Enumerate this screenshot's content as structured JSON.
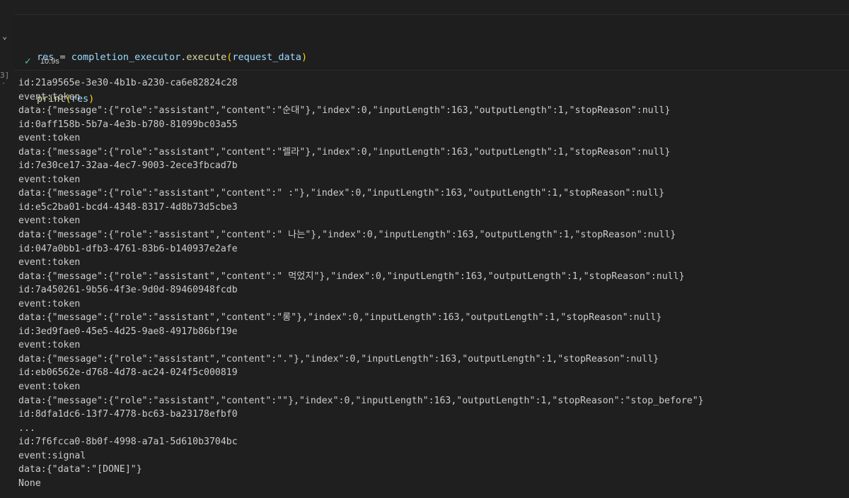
{
  "cell": {
    "code_line_1": {
      "var": "res",
      "op": " = ",
      "obj": "completion_executor",
      "dot": ".",
      "method": "execute",
      "open": "(",
      "arg": "request_data",
      "close": ")"
    },
    "code_line_2": {
      "fn": "print",
      "open": "(",
      "arg": "res",
      "close": ")"
    },
    "execution_count": "3]",
    "status_icon": "check-icon",
    "duration": "10.9s"
  },
  "output": {
    "lines": [
      "id:21a9565e-3e30-4b1b-a230-ca6e82824c28",
      "event:token",
      "data:{\"message\":{\"role\":\"assistant\",\"content\":\"순대\"},\"index\":0,\"inputLength\":163,\"outputLength\":1,\"stopReason\":null}",
      "id:0aff158b-5b7a-4e3b-b780-81099bc03a55",
      "event:token",
      "data:{\"message\":{\"role\":\"assistant\",\"content\":\"렐라\"},\"index\":0,\"inputLength\":163,\"outputLength\":1,\"stopReason\":null}",
      "id:7e30ce17-32aa-4ec7-9003-2ece3fbcad7b",
      "event:token",
      "data:{\"message\":{\"role\":\"assistant\",\"content\":\" :\"},\"index\":0,\"inputLength\":163,\"outputLength\":1,\"stopReason\":null}",
      "id:e5c2ba01-bcd4-4348-8317-4d8b73d5cbe3",
      "event:token",
      "data:{\"message\":{\"role\":\"assistant\",\"content\":\" 나는\"},\"index\":0,\"inputLength\":163,\"outputLength\":1,\"stopReason\":null}",
      "id:047a0bb1-dfb3-4761-83b6-b140937e2afe",
      "event:token",
      "data:{\"message\":{\"role\":\"assistant\",\"content\":\" 먹었지\"},\"index\":0,\"inputLength\":163,\"outputLength\":1,\"stopReason\":null}",
      "id:7a450261-9b56-4f3e-9d0d-89460948fcdb",
      "event:token",
      "data:{\"message\":{\"role\":\"assistant\",\"content\":\"롱\"},\"index\":0,\"inputLength\":163,\"outputLength\":1,\"stopReason\":null}",
      "id:3ed9fae0-45e5-4d25-9ae8-4917b86bf19e",
      "event:token",
      "data:{\"message\":{\"role\":\"assistant\",\"content\":\".\"},\"index\":0,\"inputLength\":163,\"outputLength\":1,\"stopReason\":null}",
      "id:eb06562e-d768-4d78-ac24-024f5c000819",
      "event:token",
      "data:{\"message\":{\"role\":\"assistant\",\"content\":\"\"},\"index\":0,\"inputLength\":163,\"outputLength\":1,\"stopReason\":\"stop_before\"}",
      "id:8dfa1dc6-13f7-4778-bc63-ba23178efbf0",
      "...",
      "id:7f6fcca0-8b0f-4998-a7a1-5d610b3704bc",
      "event:signal",
      "data:{\"data\":\"[DONE]\"}",
      "None"
    ]
  },
  "colors": {
    "background": "#1f1f1f",
    "text": "#cccccc",
    "variable": "#9cdcfe",
    "function": "#dcdcaa",
    "bracket": "#ffd700",
    "success": "#4ec98a"
  }
}
